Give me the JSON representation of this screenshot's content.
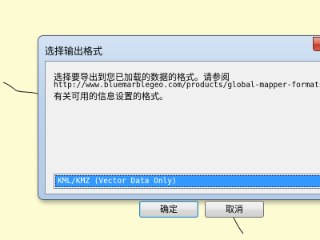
{
  "dialog": {
    "title": "选择输出格式",
    "message_line1": "选择要导出到您已加载的数据的格式。请参阅",
    "message_line2": "http://www.bluemarblegeo.com/products/global-mapper-formats",
    "message_line3": "有关可用的信息设置的格式。",
    "selected_format": "KML/KMZ (Vector Data Only)",
    "ok_label": "确定",
    "cancel_label": "取消"
  }
}
